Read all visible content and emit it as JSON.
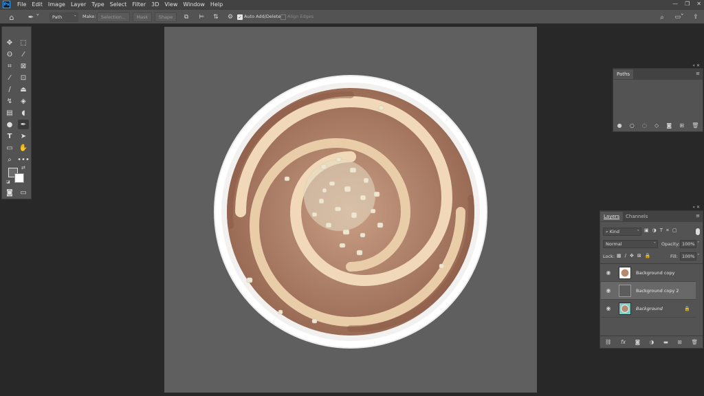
{
  "app": {
    "logo": "Ps"
  },
  "menu": [
    "File",
    "Edit",
    "Image",
    "Layer",
    "Type",
    "Select",
    "Filter",
    "3D",
    "View",
    "Window",
    "Help"
  ],
  "options": {
    "mode": "Path",
    "make_label": "Make:",
    "selection_btn": "Selection...",
    "mask_btn": "Mask",
    "shape_btn": "Shape",
    "auto_add_delete": "Auto Add/Delete",
    "align_edges": "Align Edges",
    "auto_add_checked": true,
    "align_edges_checked": false
  },
  "paths_panel": {
    "tab": "Paths"
  },
  "layers_panel": {
    "tabs": [
      "Layers",
      "Channels"
    ],
    "filter_kind": "Kind",
    "blend_mode": "Normal",
    "opacity_label": "Opacity:",
    "opacity": "100%",
    "lock_label": "Lock:",
    "fill_label": "Fill:",
    "fill": "100%",
    "layers": [
      {
        "name": "Background copy",
        "visible": true,
        "selected": false,
        "locked": false
      },
      {
        "name": "Background copy 2",
        "visible": true,
        "selected": true,
        "locked": false
      },
      {
        "name": "Background",
        "visible": true,
        "selected": false,
        "locked": true
      }
    ]
  },
  "colors": {
    "accent": "#31a8ff",
    "canvas": "#5f5f5f",
    "panel": "#535353",
    "bg": "#282828"
  }
}
